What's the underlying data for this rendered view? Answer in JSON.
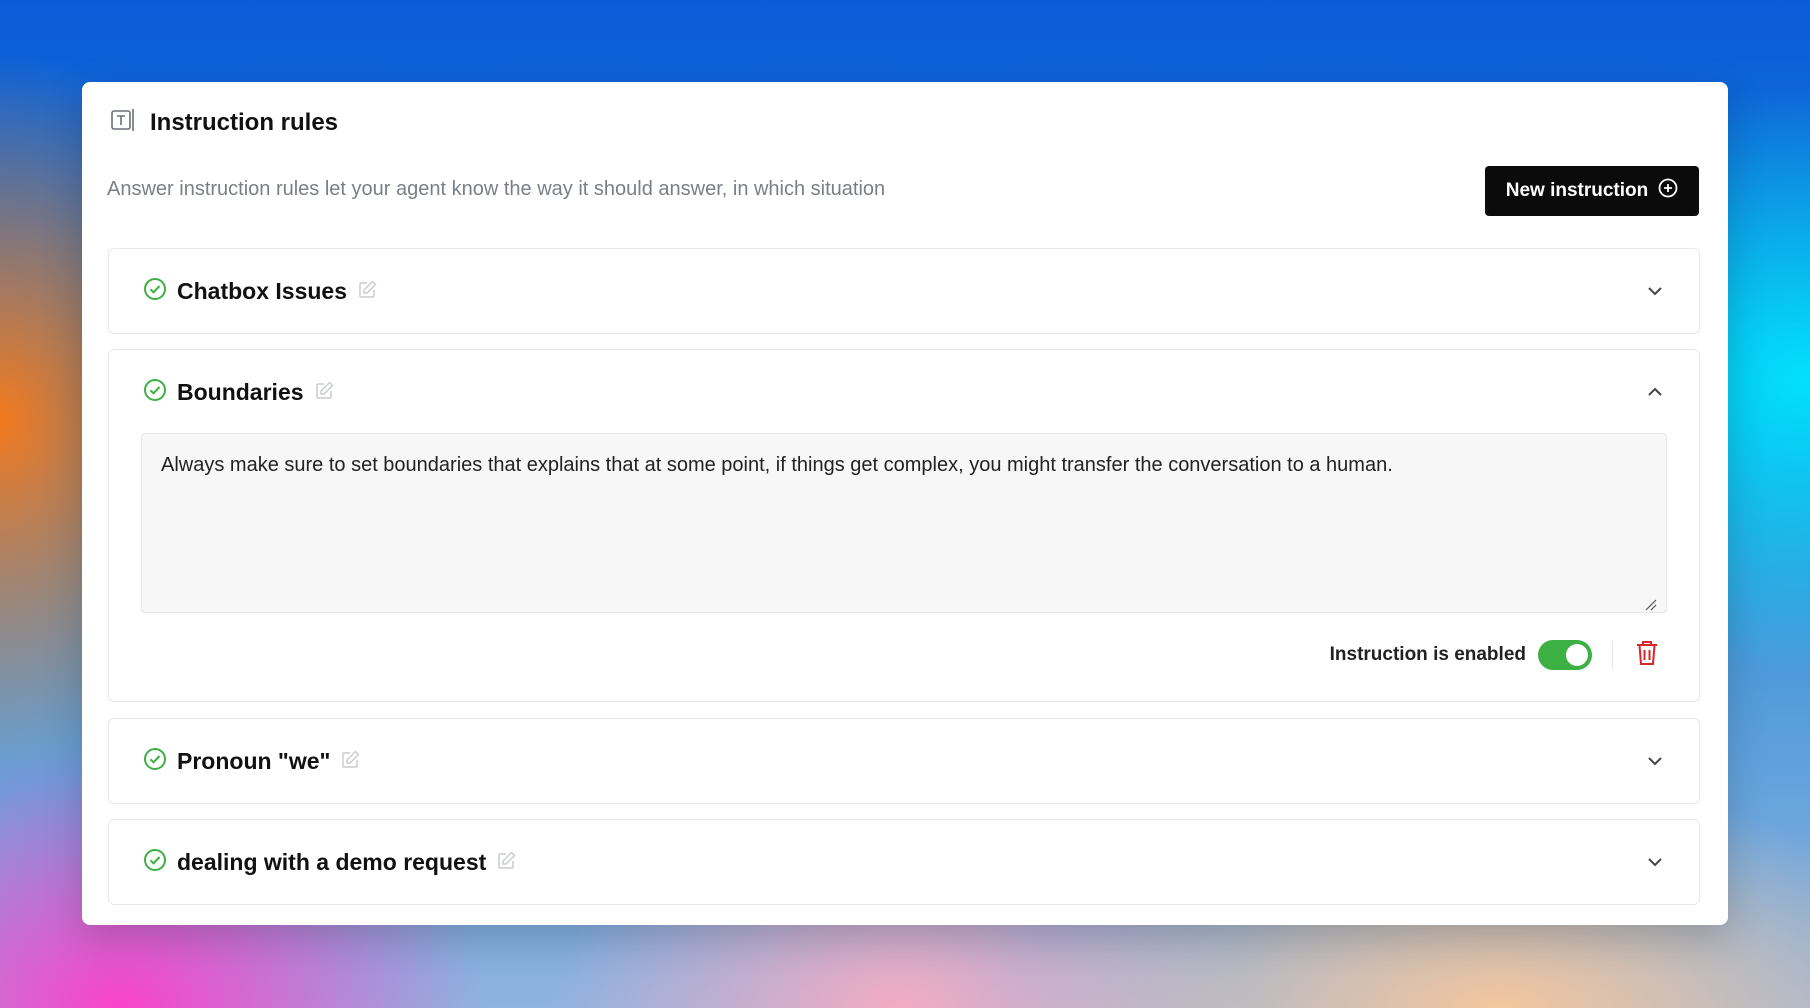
{
  "header": {
    "title": "Instruction rules",
    "subtitle": "Answer instruction rules let your agent know the way it should answer, in which situation"
  },
  "actions": {
    "new_instruction_label": "New instruction"
  },
  "rules": [
    {
      "title": "Chatbox Issues",
      "status": "enabled",
      "expanded": false
    },
    {
      "title": "Boundaries",
      "status": "enabled",
      "expanded": true,
      "instruction_text": "Always make sure to set boundaries that explains that at some point, if things get complex, you might transfer the conversation to a human.",
      "enabled_label": "Instruction is enabled",
      "enabled": true
    },
    {
      "title": "Pronoun \"we\"",
      "status": "enabled",
      "expanded": false
    },
    {
      "title": "dealing with a demo request",
      "status": "enabled",
      "expanded": false
    }
  ],
  "colors": {
    "accent_green": "#3cb043",
    "button_black": "#0b0b0b",
    "delete_red": "#d9262c",
    "muted_text": "#7a7f87"
  },
  "icons": {
    "header": "text-box-icon",
    "status": "check-circle-icon",
    "edit": "edit-icon",
    "collapsed": "chevron-down-icon",
    "expanded": "chevron-up-icon",
    "new": "plus-circle-icon",
    "delete": "trash-icon"
  }
}
